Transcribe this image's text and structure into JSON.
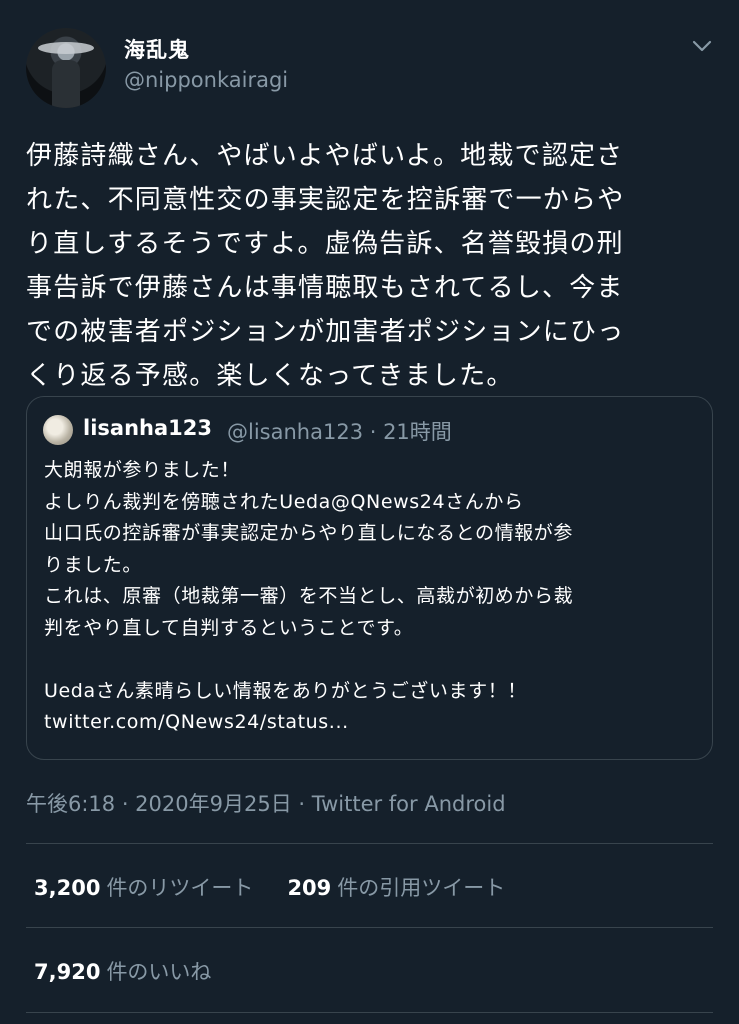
{
  "author": {
    "display_name": "海乱鬼",
    "handle": "@nipponkairagi"
  },
  "tweet": {
    "text": "伊藤詩織さん、やばいよやばいよ。地裁で認定さ\nれた、不同意性交の事実認定を控訴審で一からや\nり直しするそうですよ。虚偽告訴、名誉毀損の刑\n事告訴で伊藤さんは事情聴取もされてるし、今ま\nでの被害者ポジションが加害者ポジションにひっ\nくり返る予感。楽しくなってきました。"
  },
  "quoted": {
    "name": "lisanha123",
    "meta": "@lisanha123 · 21時間",
    "text": "大朗報が参りました！\nよしりん裁判を傍聴されたUeda@QNews24さんから\n山口氏の控訴審が事実認定からやり直しになるとの情報が参\nりました。\nこれは、原審（地裁第一審）を不当とし、高裁が初めから裁\n判をやり直して自判するということです。\n\nUedaさん素晴らしい情報をありがとうございます！！\ntwitter.com/QNews24/status..."
  },
  "timestamp": "午後6:18 · 2020年9月25日 · Twitter for Android",
  "stats": {
    "retweets": "3,200",
    "retweets_label": "件のリツイート",
    "quotes": "209",
    "quotes_label": "件の引用ツイート",
    "likes": "7,920",
    "likes_label": "件のいいね"
  },
  "colors": {
    "background": "#15202b",
    "secondary_text": "#8899a6",
    "border": "#38444d"
  },
  "icons": {
    "menu": "chevron-down-icon"
  }
}
